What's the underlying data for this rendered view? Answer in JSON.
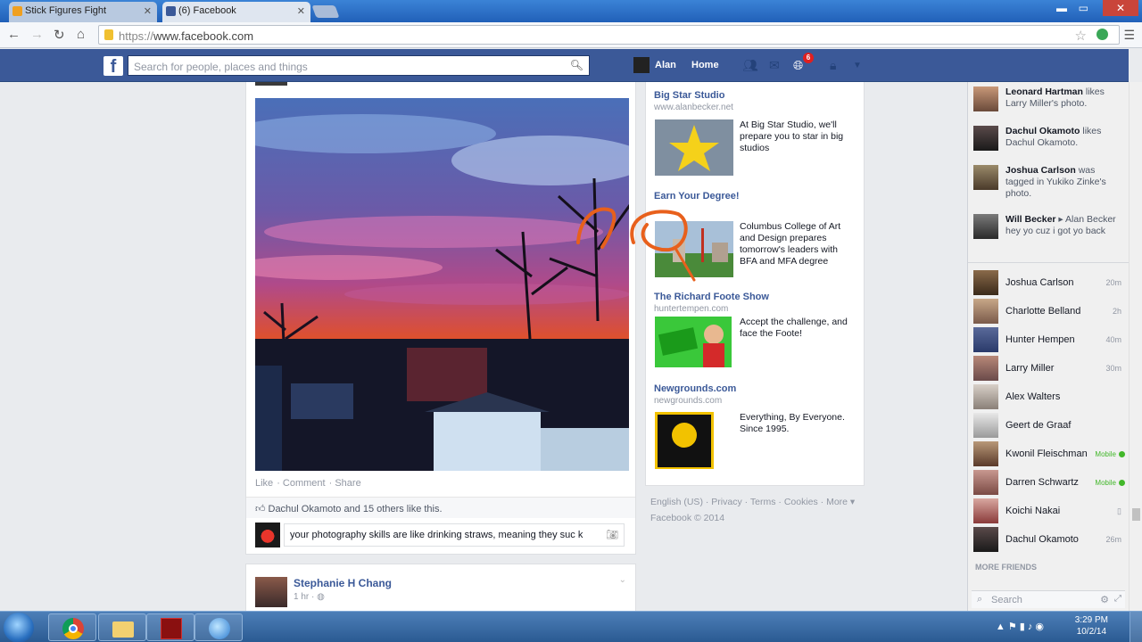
{
  "browser": {
    "tabs": [
      {
        "title": "Stick Figures Fight",
        "active": false
      },
      {
        "title": "(6) Facebook",
        "active": true
      }
    ],
    "url": "https://www.facebook.com",
    "url_display_host": "www.facebook.com",
    "url_scheme": "https://"
  },
  "fbbar": {
    "logo": "f",
    "search_placeholder": "Search for people, places and things",
    "user_name": "Alan",
    "home_label": "Home",
    "notification_count": "6"
  },
  "feed": {
    "post_actions": [
      "Like",
      "Comment",
      "Share"
    ],
    "likes_text": "Dachul Okamoto and 15 others like this.",
    "comment_draft": "your photography skills are like drinking straws, meaning they suc k",
    "next_post": {
      "author": "Stephanie H Chang",
      "time": "1 hr · "
    }
  },
  "ads": [
    {
      "title": "Big Star Studio",
      "url": "www.alanbecker.net",
      "body": "At Big Star Studio, we'll prepare you to star in big studios"
    },
    {
      "title": "Earn Your Degree!",
      "url": "",
      "body": "Columbus College of Art and Design prepares tomorrow's leaders with BFA and MFA degree"
    },
    {
      "title": "The Richard Foote Show",
      "url": "huntertempen.com",
      "body": "Accept the challenge, and face the Foote!"
    },
    {
      "title": "Newgrounds.com",
      "url": "newgrounds.com",
      "body": "Everything, By Everyone. Since 1995."
    }
  ],
  "footer": {
    "links": [
      "English (US)",
      "Privacy",
      "Terms",
      "Cookies",
      "More ▾"
    ],
    "copyright": "Facebook © 2014"
  },
  "ticker": [
    {
      "actor": "Leonard Hartman",
      "rest": " likes Larry Miller's photo."
    },
    {
      "actor": "Dachul Okamoto",
      "rest": " likes Dachul Okamoto."
    },
    {
      "actor": "Joshua Carlson",
      "rest": " was tagged in Yukiko Zinke's photo."
    },
    {
      "actor": "Will Becker",
      "rest": " ▸ Alan Becker hey yo cuz i got yo back"
    }
  ],
  "friends": [
    {
      "name": "Joshua Carlson",
      "status": "20m"
    },
    {
      "name": "Charlotte Belland",
      "status": "2h"
    },
    {
      "name": "Hunter Hempen",
      "status": "40m"
    },
    {
      "name": "Larry Miller",
      "status": "30m"
    },
    {
      "name": "Alex Walters",
      "status": ""
    },
    {
      "name": "Geert de Graaf",
      "status": ""
    },
    {
      "name": "Kwonil Fleischman",
      "status": "Mobile"
    },
    {
      "name": "Darren Schwartz",
      "status": "Mobile"
    },
    {
      "name": "Koichi Nakai",
      "status": ""
    },
    {
      "name": "Dachul Okamoto",
      "status": "26m"
    }
  ],
  "sidebar": {
    "more_friends": "MORE FRIENDS",
    "chat_search_placeholder": "Search"
  },
  "taskbar": {
    "time": "3:29 PM",
    "date": "10/2/14"
  },
  "colors": {
    "fb_blue": "#3b5998",
    "link_blue": "#3b5998",
    "online_green": "#42b72a",
    "annotation_orange": "#e8601c"
  }
}
